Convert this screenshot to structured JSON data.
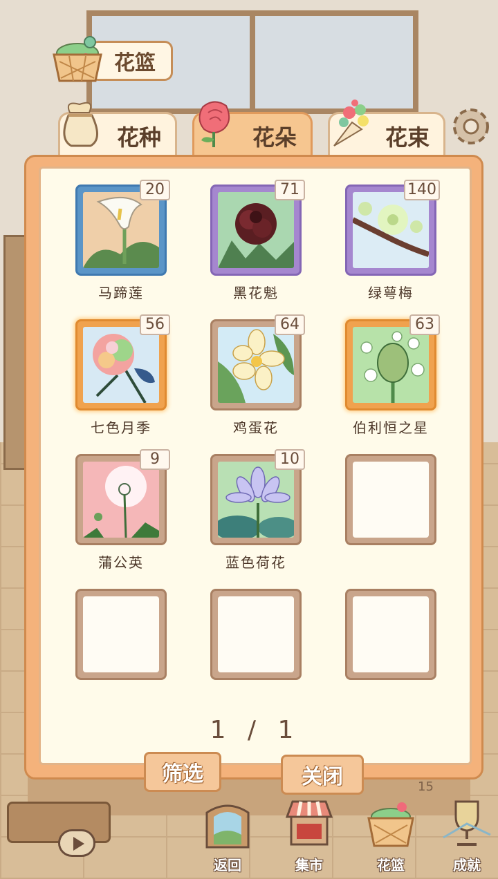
{
  "header": {
    "title": "花篮"
  },
  "tabs": [
    {
      "label": "花种",
      "active": false
    },
    {
      "label": "花朵",
      "active": true
    },
    {
      "label": "花束",
      "active": false
    }
  ],
  "items": [
    {
      "name": "马蹄莲",
      "count": "20",
      "frame": "blue"
    },
    {
      "name": "黑花魁",
      "count": "71",
      "frame": "purple"
    },
    {
      "name": "绿萼梅",
      "count": "140",
      "frame": "purple"
    },
    {
      "name": "七色月季",
      "count": "56",
      "frame": "orange"
    },
    {
      "name": "鸡蛋花",
      "count": "64",
      "frame": "brown"
    },
    {
      "name": "伯利恒之星",
      "count": "63",
      "frame": "orange"
    },
    {
      "name": "蒲公英",
      "count": "9",
      "frame": "brown"
    },
    {
      "name": "蓝色荷花",
      "count": "10",
      "frame": "brown"
    }
  ],
  "pager": {
    "text": "1 / 1"
  },
  "buttons": {
    "filter": "筛选",
    "close": "关闭"
  },
  "nav": {
    "back": "返回",
    "market": "集市",
    "basket": "花篮",
    "achievement": "成就"
  },
  "background": {
    "shelf_number": "15"
  },
  "colors": {
    "panel": "#f4b27b",
    "panel_inner": "#fffbea",
    "frame_blue": "#5b95c7",
    "frame_purple": "#a587cf",
    "frame_orange": "#f0a24e",
    "frame_brown": "#c9a58b"
  }
}
